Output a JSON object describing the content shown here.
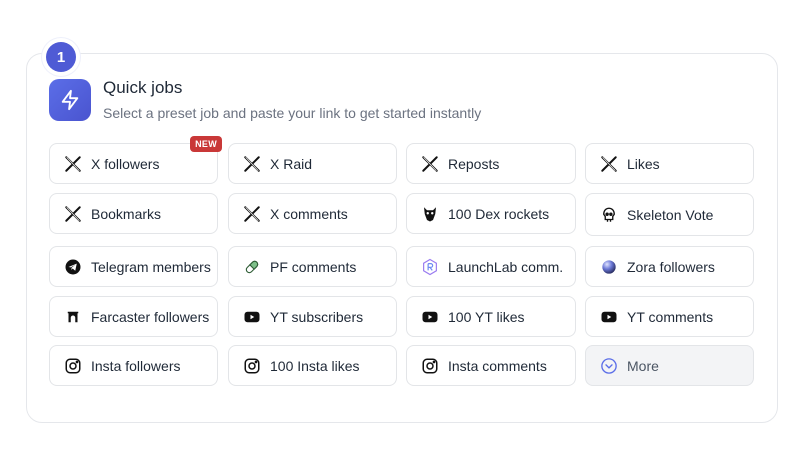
{
  "step": "1",
  "header": {
    "title": "Quick jobs",
    "subtitle": "Select a preset job and paste your link to get started instantly"
  },
  "colors": {
    "accent": "#4f5bd5",
    "new_badge": "#c93838",
    "border": "#e3e5e8"
  },
  "jobs": [
    {
      "label": "X followers",
      "icon": "x-logo-icon",
      "badge": "NEW"
    },
    {
      "label": "X Raid",
      "icon": "x-logo-icon"
    },
    {
      "label": "Reposts",
      "icon": "x-logo-icon"
    },
    {
      "label": "Likes",
      "icon": "x-logo-icon"
    },
    {
      "label": "Bookmarks",
      "icon": "x-logo-icon"
    },
    {
      "label": "X comments",
      "icon": "x-logo-icon"
    },
    {
      "label": "100 Dex rockets",
      "icon": "dex-owl-icon"
    },
    {
      "label": "Skeleton Vote",
      "icon": "skull-icon"
    },
    {
      "label": "Telegram members",
      "icon": "telegram-icon"
    },
    {
      "label": "PF comments",
      "icon": "pill-icon"
    },
    {
      "label": "LaunchLab comm.",
      "icon": "launchlab-icon"
    },
    {
      "label": "Zora followers",
      "icon": "zora-orb-icon"
    },
    {
      "label": "Farcaster followers",
      "icon": "farcaster-icon"
    },
    {
      "label": "YT subscribers",
      "icon": "youtube-icon"
    },
    {
      "label": "100 YT likes",
      "icon": "youtube-icon"
    },
    {
      "label": "YT comments",
      "icon": "youtube-icon"
    },
    {
      "label": "Insta followers",
      "icon": "instagram-icon"
    },
    {
      "label": "100 Insta likes",
      "icon": "instagram-icon"
    },
    {
      "label": "Insta comments",
      "icon": "instagram-icon"
    },
    {
      "label": "More",
      "icon": "chevron-down-circle-icon"
    }
  ]
}
